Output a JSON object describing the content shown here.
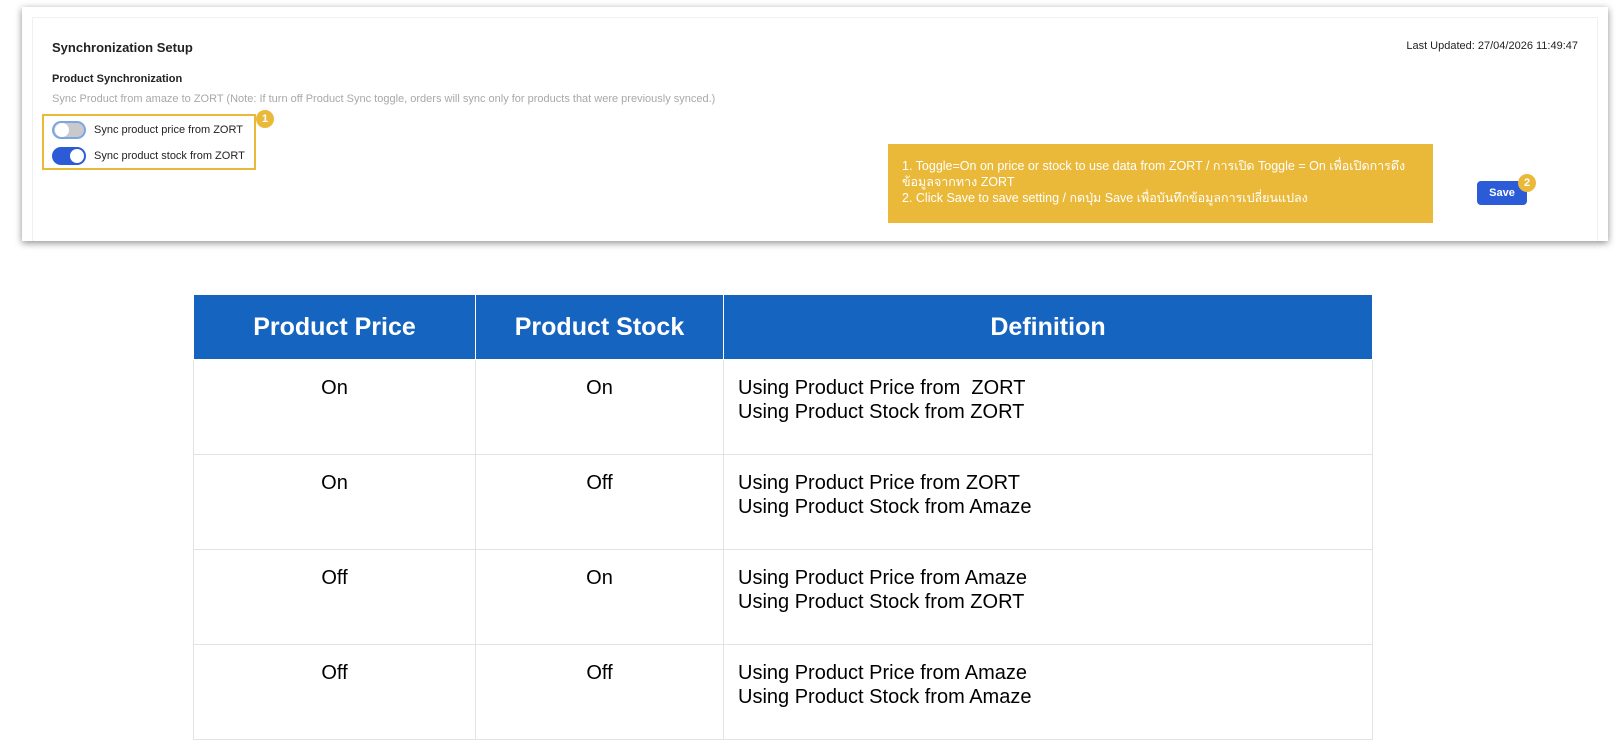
{
  "settings": {
    "title": "Synchronization Setup",
    "last_updated": "Last Updated: 27/04/2026 11:49:47",
    "section_title": "Product Synchronization",
    "note": "Sync Product from amaze to ZORT (Note: If turn off Product Sync toggle, orders will sync only for products that were previously synced.)",
    "toggles": [
      {
        "label": "Sync product price from ZORT",
        "state": "off"
      },
      {
        "label": "Sync product stock from ZORT",
        "state": "on"
      }
    ],
    "save_label": "Save",
    "badges": [
      "1",
      "2"
    ],
    "callout_lines": [
      "1. Toggle=On on price or stock to use data from ZORT / การเปิด Toggle = On เพื่อเปิดการดึงข้อมูลจากทาง ZORT",
      "2. Click Save to save setting / กดปุ่ม Save เพื่อบันทึกข้อมูลการเปลี่ยนแปลง"
    ]
  },
  "table": {
    "headers": [
      "Product Price",
      "Product Stock",
      "Definition"
    ],
    "rows": [
      {
        "price": "On",
        "stock": "On",
        "definition": [
          "Using Product Price from  ZORT",
          "Using Product Stock from ZORT"
        ]
      },
      {
        "price": "On",
        "stock": "Off",
        "definition": [
          "Using Product Price from ZORT",
          "Using Product Stock from Amaze"
        ]
      },
      {
        "price": "Off",
        "stock": "On",
        "definition": [
          "Using Product Price from Amaze",
          "Using Product Stock from ZORT"
        ]
      },
      {
        "price": "Off",
        "stock": "Off",
        "definition": [
          "Using Product Price from Amaze",
          "Using Product Stock from Amaze"
        ]
      }
    ]
  },
  "colors": {
    "accent": "#2b5bd7",
    "highlight": "#eab93a",
    "table_header": "#1565c0"
  }
}
